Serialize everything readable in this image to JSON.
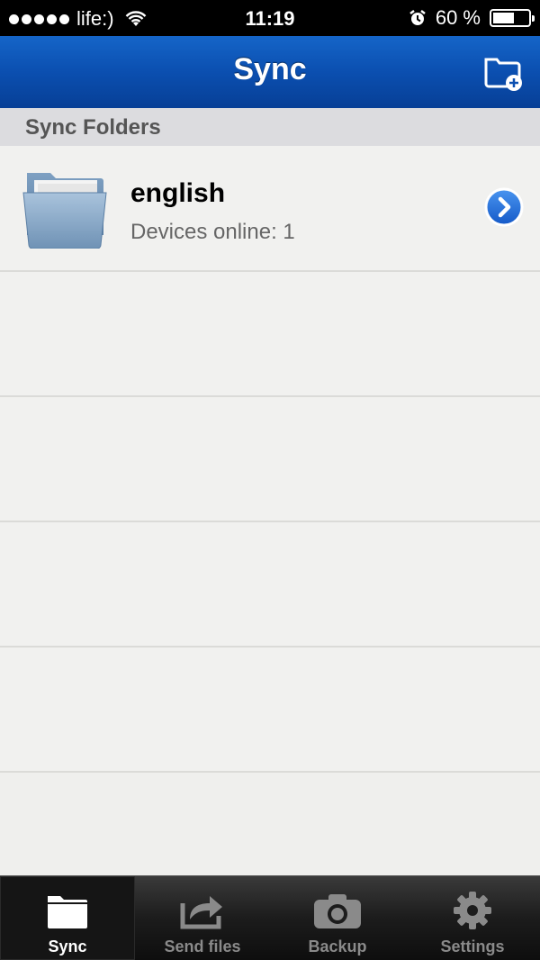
{
  "status_bar": {
    "carrier": "life:)",
    "time": "11:19",
    "battery_text": "60 %",
    "battery_level": 0.6
  },
  "nav": {
    "title": "Sync",
    "add_icon": "add-folder-icon"
  },
  "section": {
    "header": "Sync Folders"
  },
  "folders": [
    {
      "name": "english",
      "status": "Devices online: 1"
    }
  ],
  "tabs": [
    {
      "label": "Sync",
      "icon": "folder-icon",
      "active": true
    },
    {
      "label": "Send files",
      "icon": "share-arrow-icon",
      "active": false
    },
    {
      "label": "Backup",
      "icon": "camera-icon",
      "active": false
    },
    {
      "label": "Settings",
      "icon": "gear-icon",
      "active": false
    }
  ],
  "colors": {
    "nav_blue": "#0b4fb0",
    "accent_blue": "#1a6fe0",
    "tab_active_text": "#ffffff",
    "tab_inactive_text": "#8a8a8a"
  }
}
